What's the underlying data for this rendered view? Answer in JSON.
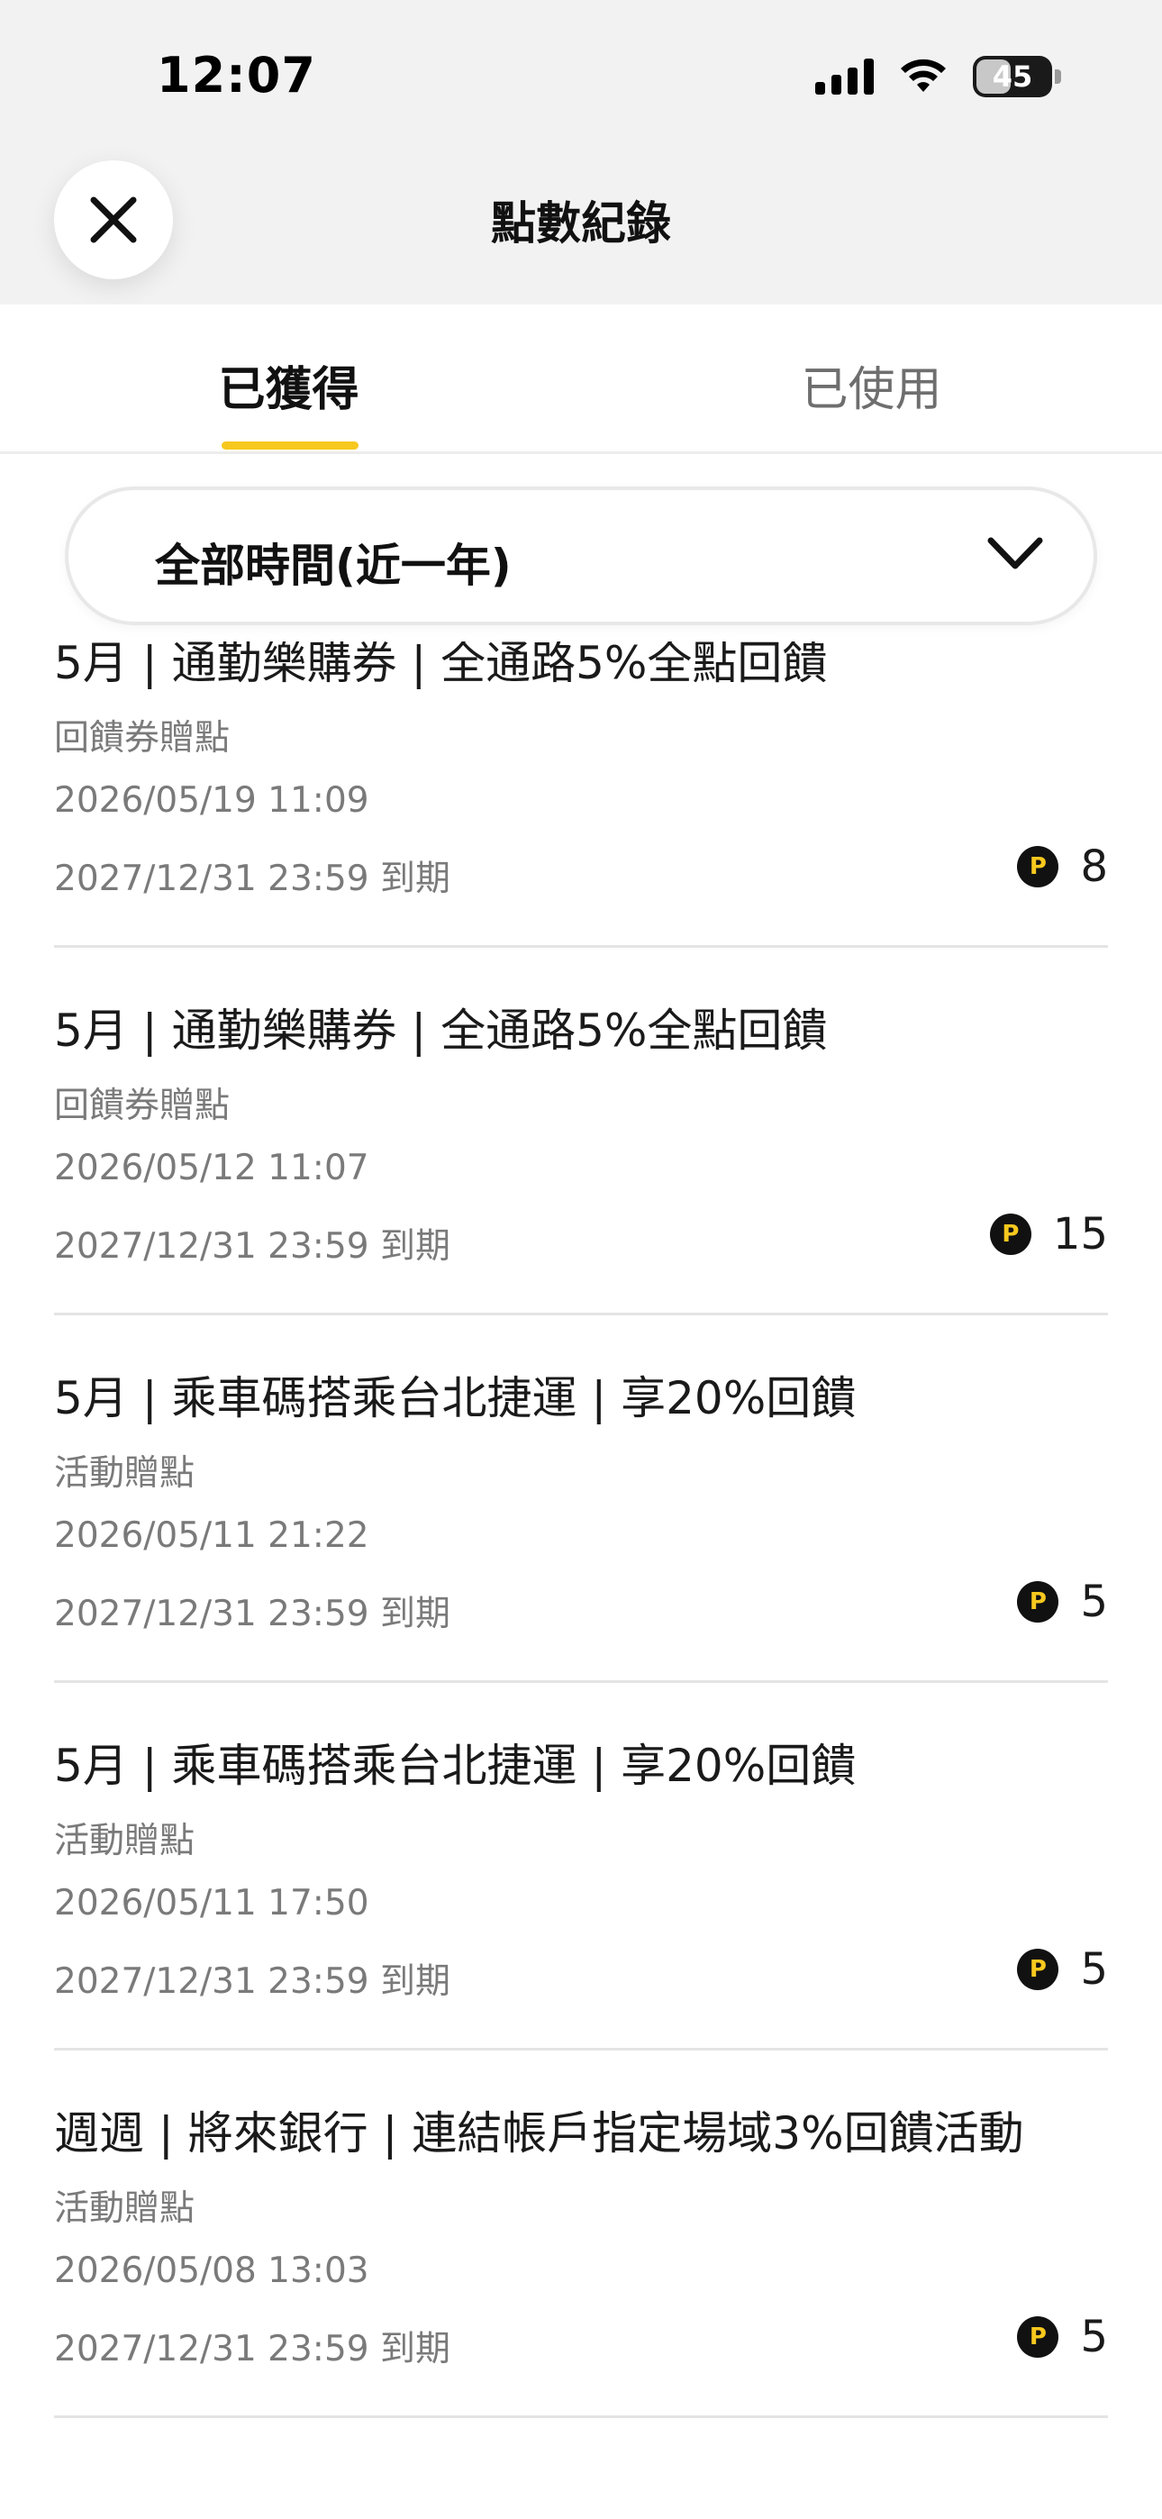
{
  "status_bar": {
    "time": "12:07",
    "battery": "45",
    "icons": [
      "cellular-signal-icon",
      "wifi-icon",
      "battery-icon"
    ]
  },
  "header": {
    "title": "點數紀錄",
    "close_icon": "close-icon"
  },
  "tabs": [
    {
      "label": "已獲得",
      "active": true
    },
    {
      "label": "已使用",
      "active": false
    }
  ],
  "filter": {
    "label": "全部時間(近一年)",
    "icon": "chevron-down-icon"
  },
  "records": [
    {
      "title": "5月 | 通勤樂購券 | 全通路5%全點回饋",
      "type": "回饋券贈點",
      "date": "2026/05/19 11:09",
      "expiry": "2027/12/31 23:59 到期",
      "points": "8"
    },
    {
      "title": "5月 | 通勤樂購券 | 全通路5%全點回饋",
      "type": "回饋券贈點",
      "date": "2026/05/12 11:07",
      "expiry": "2027/12/31 23:59 到期",
      "points": "15"
    },
    {
      "title": "5月 | 乘車碼搭乘台北捷運 | 享20%回饋",
      "type": "活動贈點",
      "date": "2026/05/11 21:22",
      "expiry": "2027/12/31 23:59 到期",
      "points": "5"
    },
    {
      "title": "5月 | 乘車碼搭乘台北捷運 | 享20%回饋",
      "type": "活動贈點",
      "date": "2026/05/11 17:50",
      "expiry": "2027/12/31 23:59 到期",
      "points": "5"
    },
    {
      "title": "週週 | 將來銀行 | 連結帳戶指定場域3%回饋活動",
      "type": "活動贈點",
      "date": "2026/05/08 13:03",
      "expiry": "2027/12/31 23:59 到期",
      "points": "5"
    }
  ],
  "point_icon_letter": "P",
  "colors": {
    "accent": "#f7c81e",
    "header_bg": "#f2f2f2",
    "secondary_text": "#7a7a7a"
  }
}
